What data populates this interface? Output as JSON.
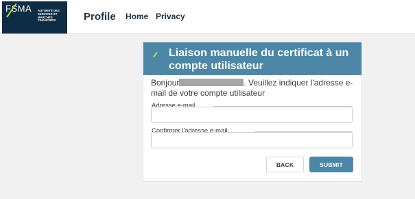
{
  "colors": {
    "logo_bg": "#0d2c45",
    "logo_accent": "#b9d33a",
    "header_bg": "#4d87a8",
    "page_bg": "#f1f1f1"
  },
  "navbar": {
    "logo_text": "FSMA",
    "logo_subtitle": "AUTORITÉ DES SERVICES ET MARCHÉS FINANCIERS",
    "brand": "Profile",
    "links": [
      {
        "label": "Home"
      },
      {
        "label": "Privacy"
      }
    ]
  },
  "card": {
    "icon": "slash-icon",
    "title": "Liaison manuelle du certificat à un compte utilisateur",
    "greeting": "Bonjour",
    "intro_rest": ". Veuillez indiquer l'adresse e-mail de votre compte utilisateur",
    "fields": [
      {
        "label": "Adresse e-mail",
        "value": ""
      },
      {
        "label": "Confirmer l'adresse e-mail",
        "value": ""
      }
    ],
    "buttons": {
      "back": "BACK",
      "submit": "SUBMIT"
    }
  }
}
